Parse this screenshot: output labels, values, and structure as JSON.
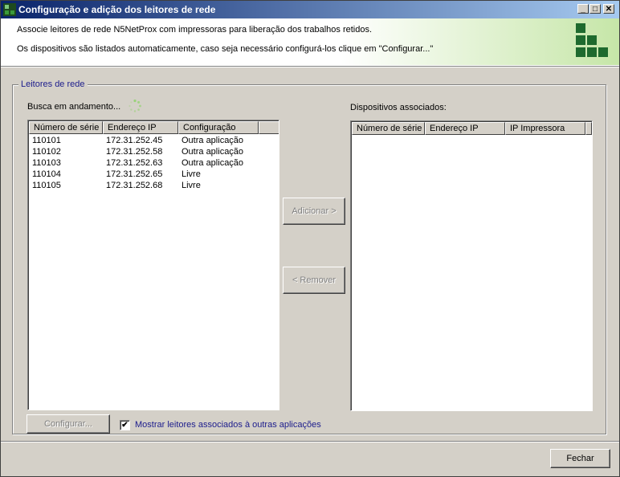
{
  "window": {
    "title": "Configuração e adição dos leitores de rede",
    "controls": {
      "minimize": "_",
      "maximize": "□",
      "close": "✕"
    }
  },
  "header": {
    "line1": "Associe leitores de rede N5NetProx com impressoras para liberação dos trabalhos retidos.",
    "line2": "Os dispositivos são listados automaticamente, caso seja necessário configurá-los clique em \"Configurar...\"",
    "logo_color": "#1e6a2e",
    "gradient_end_color": "#c6e6a8"
  },
  "group": {
    "legend": "Leitores de rede",
    "legend_color": "#1c1c8c"
  },
  "search": {
    "status": "Busca em andamento...",
    "spinner_icon": "loading-spinner-icon"
  },
  "network_readers": {
    "columns": [
      "Número de série",
      "Endereço IP",
      "Configuração"
    ],
    "rows": [
      [
        "110101",
        "172.31.252.45",
        "Outra aplicação"
      ],
      [
        "110102",
        "172.31.252.58",
        "Outra aplicação"
      ],
      [
        "110103",
        "172.31.252.63",
        "Outra aplicação"
      ],
      [
        "110104",
        "172.31.252.65",
        "Livre"
      ],
      [
        "110105",
        "172.31.252.68",
        "Livre"
      ]
    ]
  },
  "associated": {
    "label": "Dispositivos associados:",
    "columns": [
      "Número de série",
      "Endereço IP",
      "IP Impressora"
    ],
    "rows": []
  },
  "buttons": {
    "add": "Adicionar >",
    "remove": "< Remover",
    "configure": "Configurar...",
    "close": "Fechar"
  },
  "show_associated": {
    "label": "Mostrar leitores associados à outras aplicações",
    "checked": true,
    "check_glyph": "✔"
  }
}
